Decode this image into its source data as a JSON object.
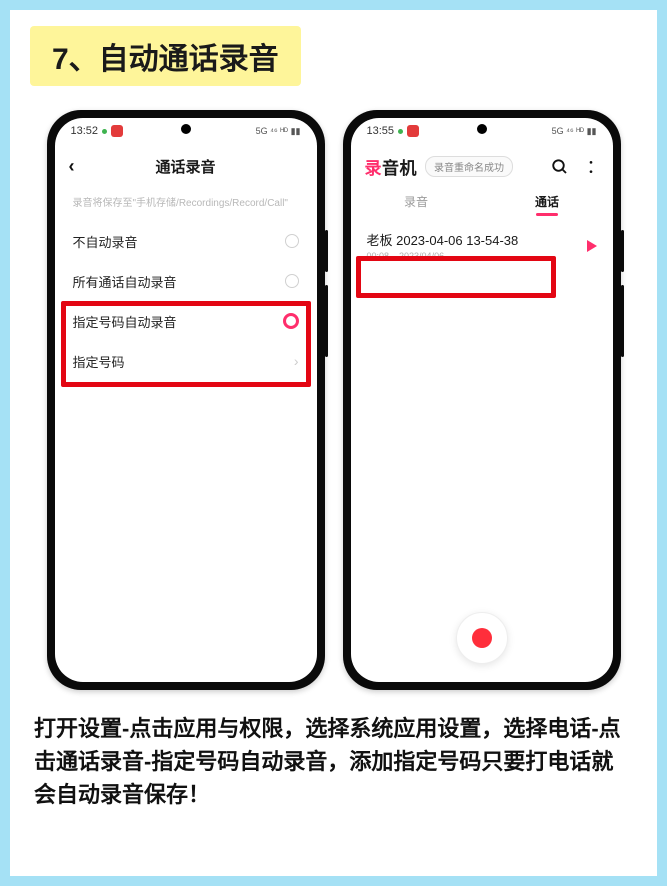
{
  "title": "7、自动通话录音",
  "phone1": {
    "status_time": "13:52",
    "status_right": "5G ⁴⁶ ᴴᴰ ▮▮",
    "header_title": "通话录音",
    "save_note": "录音将保存至\"手机存储/Recordings/Record/Call\"",
    "options": {
      "no_auto": "不自动录音",
      "all_auto": "所有通话自动录音",
      "specific_auto": "指定号码自动录音",
      "specific_numbers": "指定号码"
    }
  },
  "phone2": {
    "status_time": "13:55",
    "status_right": "5G ⁴⁶ ᴴᴰ ▮▮",
    "app_title_accent": "录",
    "app_title_rest": "音机",
    "toast": "录音重命名成功",
    "tabs": {
      "recordings": "录音",
      "calls": "通话"
    },
    "entry": {
      "title": "老板 2023-04-06 13-54-38",
      "duration": "00:08",
      "date": "2023/04/06"
    }
  },
  "caption": "打开设置-点击应用与权限，选择系统应用设置，选择电话-点击通话录音-指定号码自动录音，添加指定号码只要打电话就会自动录音保存！"
}
